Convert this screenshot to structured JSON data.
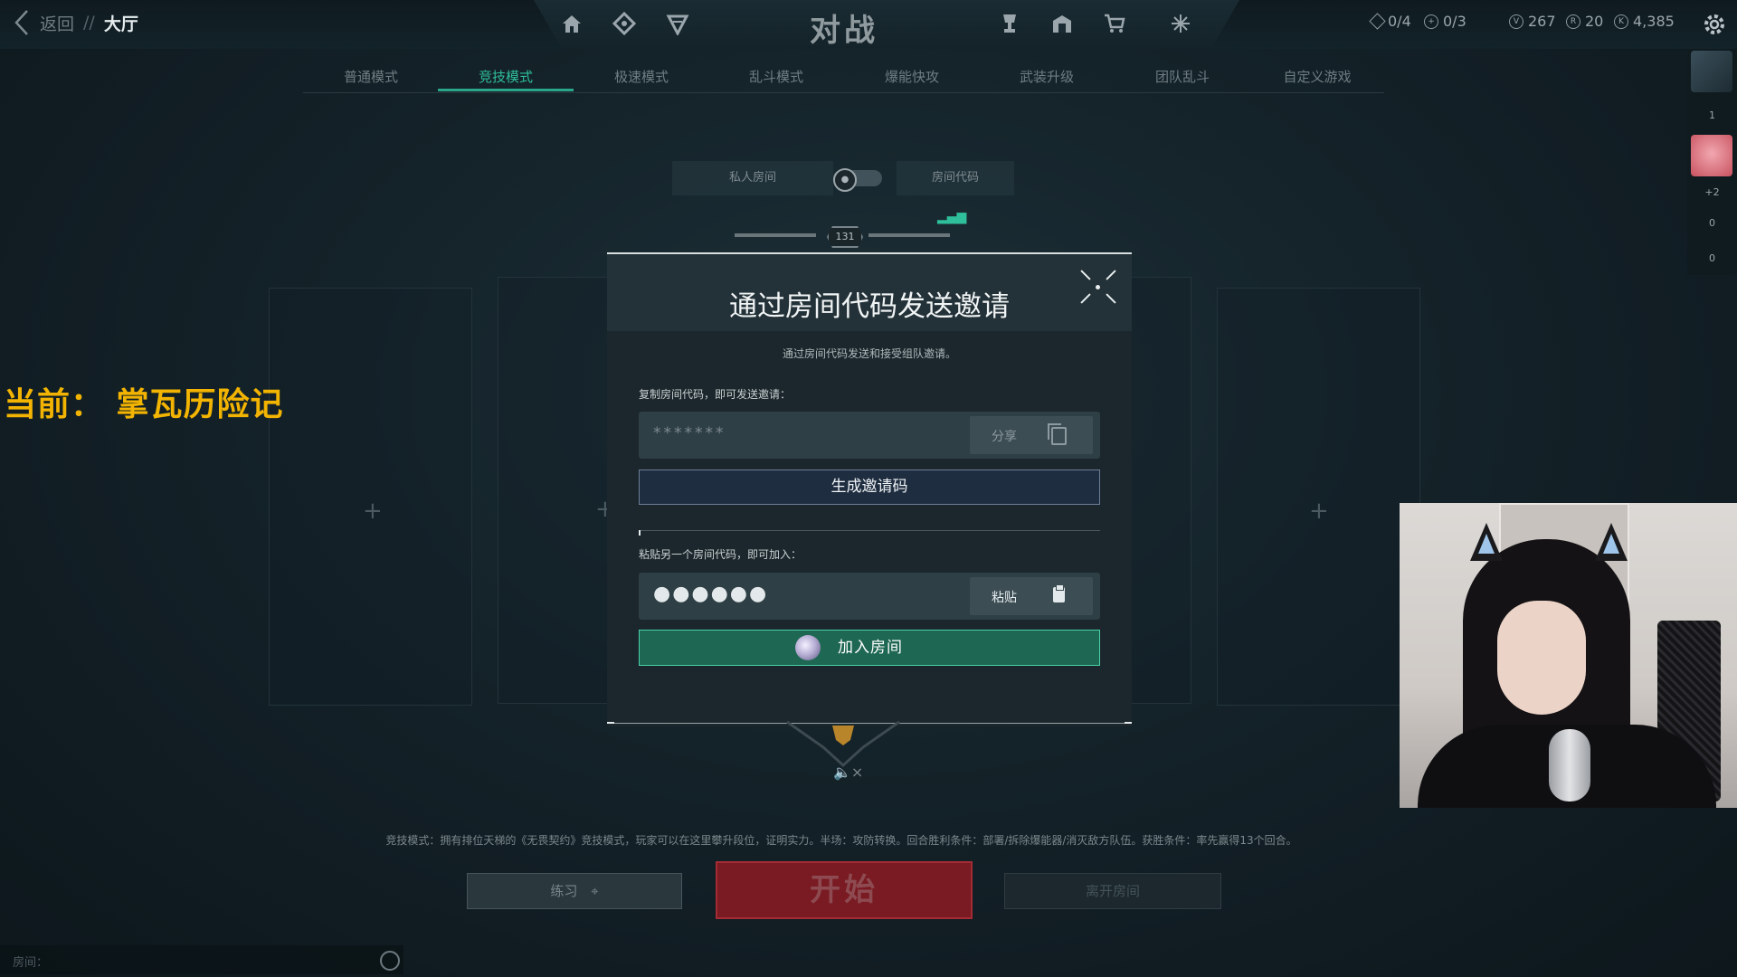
{
  "topbar": {
    "back_label": "返回",
    "separator": "//",
    "breadcrumb": "大厅",
    "title": "对战",
    "stats": {
      "missions_a": "0/4",
      "missions_b": "0/3",
      "vp": "267",
      "radianite": "20",
      "kingdom_credits": "4,385"
    }
  },
  "tabs": [
    {
      "label": "普通模式"
    },
    {
      "label": "竞技模式"
    },
    {
      "label": "极速模式"
    },
    {
      "label": "乱斗模式"
    },
    {
      "label": "爆能快攻"
    },
    {
      "label": "武装升级"
    },
    {
      "label": "团队乱斗"
    },
    {
      "label": "自定义游戏"
    }
  ],
  "active_tab": "竞技模式",
  "private_room": {
    "label": "私人房间",
    "code_label": "房间代码"
  },
  "rank_badge": {
    "level": "131"
  },
  "overlay_text": "当前： 掌瓦历险记",
  "modal": {
    "title": "通过房间代码发送邀请",
    "subtitle": "通过房间代码发送和接受组队邀请。",
    "copy_label": "复制房间代码，即可发送邀请：",
    "code_value": "*******",
    "share_button": "分享",
    "generate_button": "生成邀请码",
    "paste_label": "粘贴另一个房间代码，即可加入：",
    "paste_value": "●●●●●●",
    "paste_button": "粘贴",
    "join_button": "加入房间"
  },
  "footer": {
    "description": "竞技模式：拥有排位天梯的《无畏契约》竞技模式，玩家可以在这里攀升段位，证明实力。半场：攻防转换。回合胜利条件：部署/拆除爆能器/消灭敌方队伍。获胜条件：率先赢得13个回合。",
    "practice_button": "练习",
    "start_button": "开始",
    "leave_button": "离开房间",
    "chat_label": "房间："
  },
  "sidebar": {
    "count_1": "1",
    "party_extra": "+2",
    "count_2": "0",
    "count_3": "0"
  },
  "colors": {
    "accent": "#2fbf9a",
    "start": "#7a1a22",
    "overlay_text": "#f2b400"
  }
}
